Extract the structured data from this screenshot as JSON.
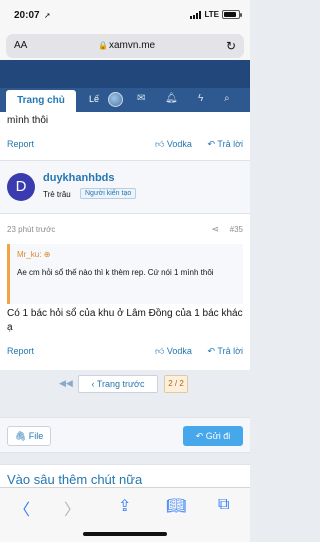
{
  "status": {
    "time": "20:07",
    "location_arrow": "➚",
    "carrier": "LTE",
    "battery_level": 0.85
  },
  "browser": {
    "aa_label": "AA",
    "url": "xamvn.me",
    "lock_icon": "lock-icon",
    "reload_icon": "reload-icon"
  },
  "nav": {
    "home_label": "Trang chủ",
    "more_label": "Lế"
  },
  "post1": {
    "text": "mình thôi"
  },
  "actions": {
    "report": "Report",
    "like": "Vodka",
    "reply": "Trả lời"
  },
  "user": {
    "avatar_letter": "D",
    "name": "duykhanhbds",
    "title": "Trẻ trâu",
    "badge": "Người kiến tạo"
  },
  "post2": {
    "time": "23 phút trước",
    "number": "#35",
    "quote_author": "Mr_ku:",
    "quote_text": "Ae cm hỏi sổ thế nào thì k thèm rep. Cứ nói 1 mình thôi",
    "text": "Có 1 bác hỏi sổ của khu ở Lâm Đồng của 1 bác khác ạ"
  },
  "pager": {
    "prev_label": "Trang trước",
    "page": "2 / 2"
  },
  "reply": {
    "file_label": "File",
    "send_label": "Gửi đi"
  },
  "section": {
    "deeper_title": "Vào sâu thêm chút nữa"
  },
  "colors": {
    "header": "#21477b",
    "nav": "#2d5990",
    "link": "#2577b1",
    "send": "#47a7eb",
    "quote_border": "#f3a447"
  }
}
